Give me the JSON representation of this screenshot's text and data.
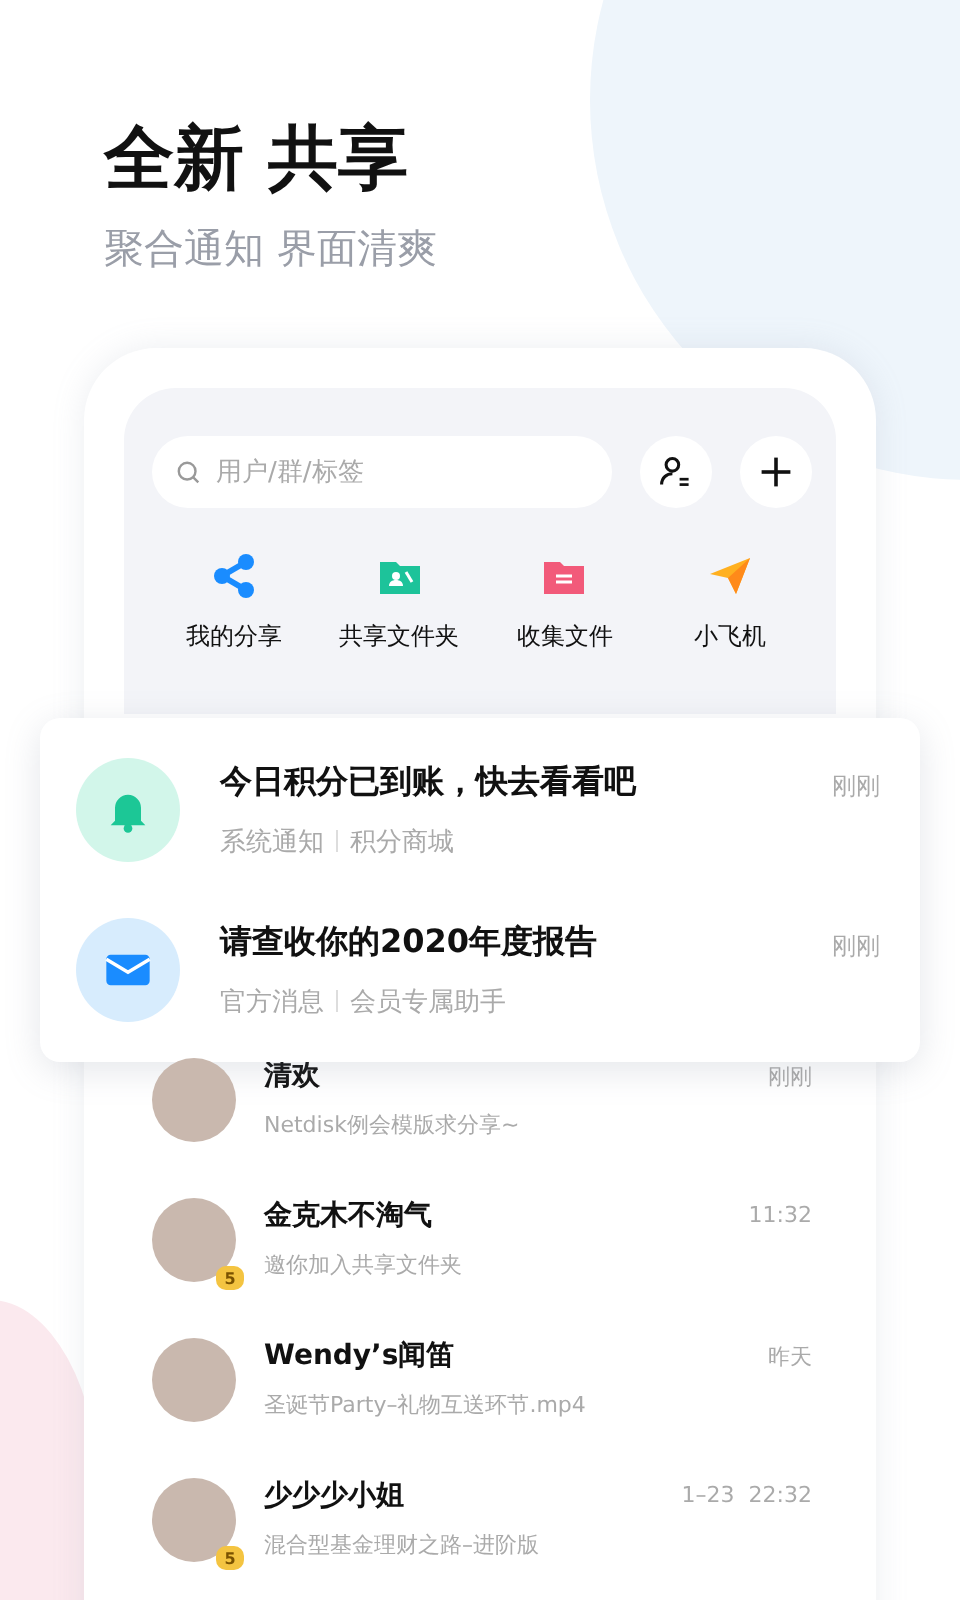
{
  "header": {
    "title": "全新 共享",
    "subtitle": "聚合通知 界面清爽"
  },
  "search": {
    "placeholder": "用户/群/标签"
  },
  "shortcuts": [
    {
      "label": "我的分享",
      "kind": "share"
    },
    {
      "label": "共享文件夹",
      "kind": "shared-folder"
    },
    {
      "label": "收集文件",
      "kind": "collect-folder"
    },
    {
      "label": "小飞机",
      "kind": "plane"
    }
  ],
  "notifications": [
    {
      "kind": "bell",
      "title": "今日积分已到账，快去看看吧",
      "source": "系统通知",
      "channel": "积分商城",
      "time": "刚刚"
    },
    {
      "kind": "mail",
      "title": "请查收你的2020年度报告",
      "source": "官方消息",
      "channel": "会员专属助手",
      "time": "刚刚"
    }
  ],
  "chats": [
    {
      "name": "清欢",
      "preview": "Netdisk例会模版求分享~",
      "time": "刚刚"
    },
    {
      "name": "金克木不淘气",
      "preview": "邀你加入共享文件夹",
      "time": "11:32",
      "badge": "5"
    },
    {
      "name": "Wendy’s闻笛",
      "preview": "圣诞节Party–礼物互送环节.mp4",
      "time": "昨天"
    },
    {
      "name": "少少少小姐",
      "preview": "混合型基金理财之路–进阶版",
      "time": "1–23  22:32",
      "badge": "5"
    }
  ]
}
